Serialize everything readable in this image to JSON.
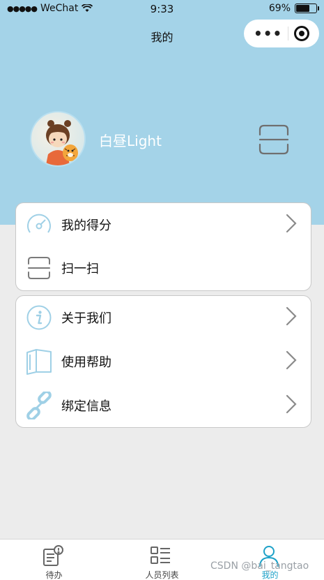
{
  "status_bar": {
    "carrier": "WeChat",
    "time": "9:33",
    "battery": "69%",
    "battery_level": 0.69
  },
  "nav": {
    "title": "我的",
    "more_icon": "more-dots-icon",
    "close_icon": "target-icon"
  },
  "profile": {
    "username": "白昼Light",
    "avatar_icon": "avatar-girl-with-tiger",
    "scan_icon": "scan-icon"
  },
  "menu": {
    "group1": [
      {
        "label": "我的得分",
        "icon": "gauge-icon",
        "has_arrow": true
      },
      {
        "label": "扫一扫",
        "icon": "scan-icon",
        "has_arrow": false
      }
    ],
    "group2": [
      {
        "label": "关于我们",
        "icon": "info-icon",
        "has_arrow": true
      },
      {
        "label": "使用帮助",
        "icon": "book-icon",
        "has_arrow": true
      },
      {
        "label": "绑定信息",
        "icon": "link-icon",
        "has_arrow": true
      }
    ]
  },
  "tabbar": {
    "tabs": [
      {
        "label": "待办",
        "icon": "todo-icon",
        "active": false
      },
      {
        "label": "人员列表",
        "icon": "list-icon",
        "active": false
      },
      {
        "label": "我的",
        "icon": "user-icon",
        "active": true
      }
    ]
  },
  "watermark": "CSDN @bai_tangtao",
  "colors": {
    "header_bg": "#a4d3e8",
    "accent": "#1da1c8",
    "icon_blue": "#9fd0e6"
  }
}
